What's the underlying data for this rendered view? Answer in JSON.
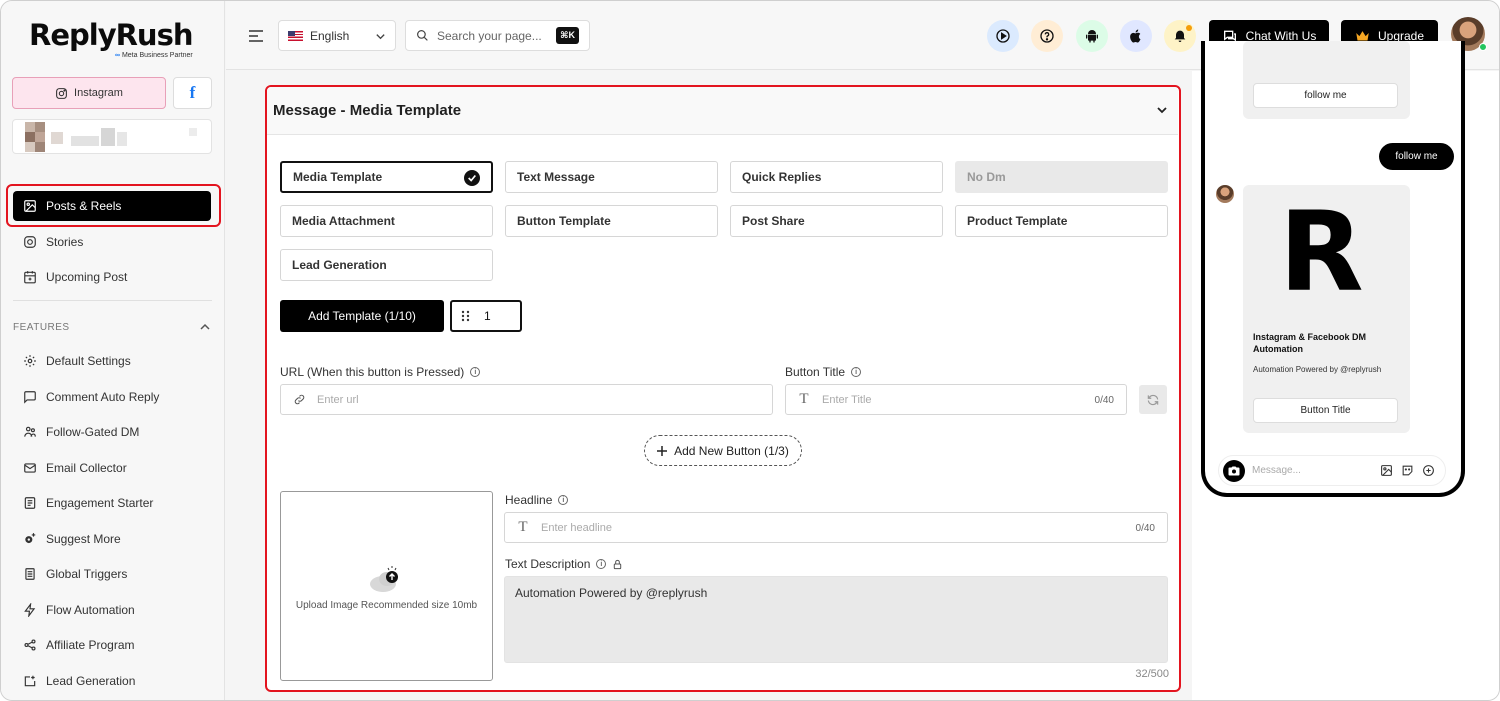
{
  "brand": {
    "name": "ReplyRush",
    "partner": "Meta Business Partner"
  },
  "accounts": {
    "instagram_label": "Instagram",
    "facebook_label": "f"
  },
  "sidebar": {
    "main_items": [
      {
        "label": "Posts & Reels",
        "icon": "image-icon",
        "active": true
      },
      {
        "label": "Stories",
        "icon": "instagram-icon"
      },
      {
        "label": "Upcoming Post",
        "icon": "calendar-icon"
      }
    ],
    "features_label": "FEATURES",
    "feature_items": [
      {
        "label": "Default Settings",
        "icon": "gear-icon"
      },
      {
        "label": "Comment Auto Reply",
        "icon": "comment-icon"
      },
      {
        "label": "Follow-Gated DM",
        "icon": "users-icon"
      },
      {
        "label": "Email Collector",
        "icon": "mail-icon"
      },
      {
        "label": "Engagement Starter",
        "icon": "list-icon"
      },
      {
        "label": "Suggest More",
        "icon": "gear-plus-icon"
      },
      {
        "label": "Global Triggers",
        "icon": "document-icon"
      },
      {
        "label": "Flow Automation",
        "icon": "lightning-icon"
      },
      {
        "label": "Affiliate Program",
        "icon": "share-icon"
      },
      {
        "label": "Lead Generation",
        "icon": "lead-icon"
      }
    ]
  },
  "header": {
    "language": "English",
    "search_placeholder": "Search your page...",
    "shortcut": "⌘K",
    "chat_label": "Chat With Us",
    "upgrade_label": "Upgrade",
    "colors": {
      "play": "#dbeafe",
      "help": "#ffedd5",
      "android": "#dcfce7",
      "apple": "#e0e7ff",
      "bell": "#fef3c7"
    }
  },
  "card": {
    "title": "Message - Media Template",
    "options": [
      {
        "label": "Media Template",
        "state": "selected"
      },
      {
        "label": "Text Message"
      },
      {
        "label": "Quick Replies"
      },
      {
        "label": "No Dm",
        "state": "disabled"
      },
      {
        "label": "Media Attachment"
      },
      {
        "label": "Button Template"
      },
      {
        "label": "Post Share"
      },
      {
        "label": "Product Template"
      },
      {
        "label": "Lead Generation"
      }
    ],
    "add_template_label": "Add Template (1/10)",
    "template_count": "1",
    "url_label": "URL (When this button is Pressed)",
    "url_placeholder": "Enter url",
    "button_title_label": "Button Title",
    "button_title_placeholder": "Enter Title",
    "button_title_count": "0/40",
    "add_button_label": "Add New Button (1/3)",
    "upload_text": "Upload Image Recommended size 10mb",
    "headline_label": "Headline",
    "headline_placeholder": "Enter headline",
    "headline_count": "0/40",
    "description_label": "Text Description",
    "description_value": "Automation Powered by @replyrush",
    "description_count": "32/500"
  },
  "preview": {
    "follow_me_button": "follow me",
    "follow_me_message": "follow me",
    "card_letter": "R",
    "card_title": "Instagram & Facebook DM Automation",
    "card_subtitle": "Automation Powered by @replyrush",
    "card_button": "Button Title",
    "message_placeholder": "Message..."
  }
}
